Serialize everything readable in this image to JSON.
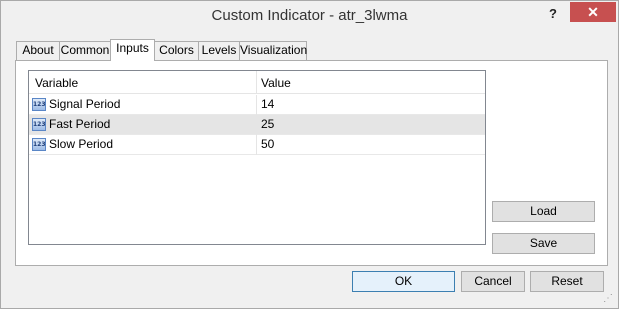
{
  "window": {
    "title": "Custom Indicator - atr_3lwma",
    "help_glyph": "?",
    "close_glyph": "✕"
  },
  "tabs": [
    {
      "label": "About"
    },
    {
      "label": "Common"
    },
    {
      "label": "Inputs"
    },
    {
      "label": "Colors"
    },
    {
      "label": "Levels"
    },
    {
      "label": "Visualization"
    }
  ],
  "active_tab": "Inputs",
  "inputs_table": {
    "headers": {
      "variable": "Variable",
      "value": "Value"
    },
    "rows": [
      {
        "icon": "123",
        "variable": "Signal Period",
        "value": "14"
      },
      {
        "icon": "123",
        "variable": "Fast Period",
        "value": "25"
      },
      {
        "icon": "123",
        "variable": "Slow Period",
        "value": "50"
      }
    ],
    "selected_row": 1
  },
  "side_buttons": {
    "load": "Load",
    "save": "Save"
  },
  "footer_buttons": {
    "ok": "OK",
    "cancel": "Cancel",
    "reset": "Reset"
  },
  "colors": {
    "close_button": "#c75050",
    "selected_row": "#e5e5e5",
    "default_button_border": "#3c7fb1"
  }
}
